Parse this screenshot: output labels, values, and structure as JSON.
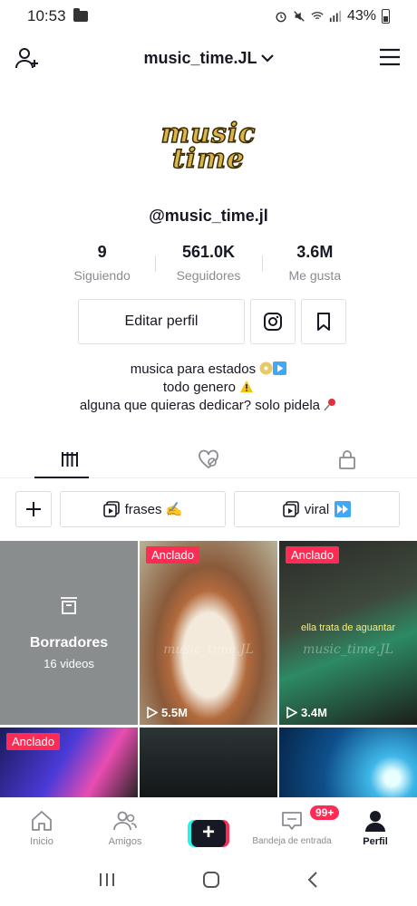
{
  "status_bar": {
    "time": "10:53",
    "battery": "43%"
  },
  "header": {
    "username": "music_time.JL"
  },
  "avatar": {
    "logo_line1": "music",
    "logo_line2": "time"
  },
  "profile": {
    "handle": "@music_time.jl"
  },
  "stats": [
    {
      "value": "9",
      "label": "Siguiendo"
    },
    {
      "value": "561.0K",
      "label": "Seguidores"
    },
    {
      "value": "3.6M",
      "label": "Me gusta"
    }
  ],
  "actions": {
    "edit_label": "Editar perfil"
  },
  "bio": {
    "line1": "musica para estados",
    "line2": "todo genero",
    "line3": "alguna que quieras dedicar? solo pidela"
  },
  "playlists": [
    {
      "label": "frases ✍️"
    },
    {
      "label": "viral"
    }
  ],
  "grid": {
    "drafts_title": "Borradores",
    "drafts_count": "16 videos",
    "pinned_label": "Anclado",
    "watermark": "music_time.JL",
    "videos": [
      {
        "views": "5.5M"
      },
      {
        "views": "3.4M",
        "caption": "ella trata de aguantar"
      }
    ]
  },
  "bottom_nav": {
    "home": "Inicio",
    "friends": "Amigos",
    "inbox": "Bandeja de entrada",
    "inbox_badge": "99+",
    "profile": "Perfil"
  },
  "colors": {
    "accent": "#fe2c55",
    "cyan": "#25f4ee",
    "text": "#161823"
  }
}
